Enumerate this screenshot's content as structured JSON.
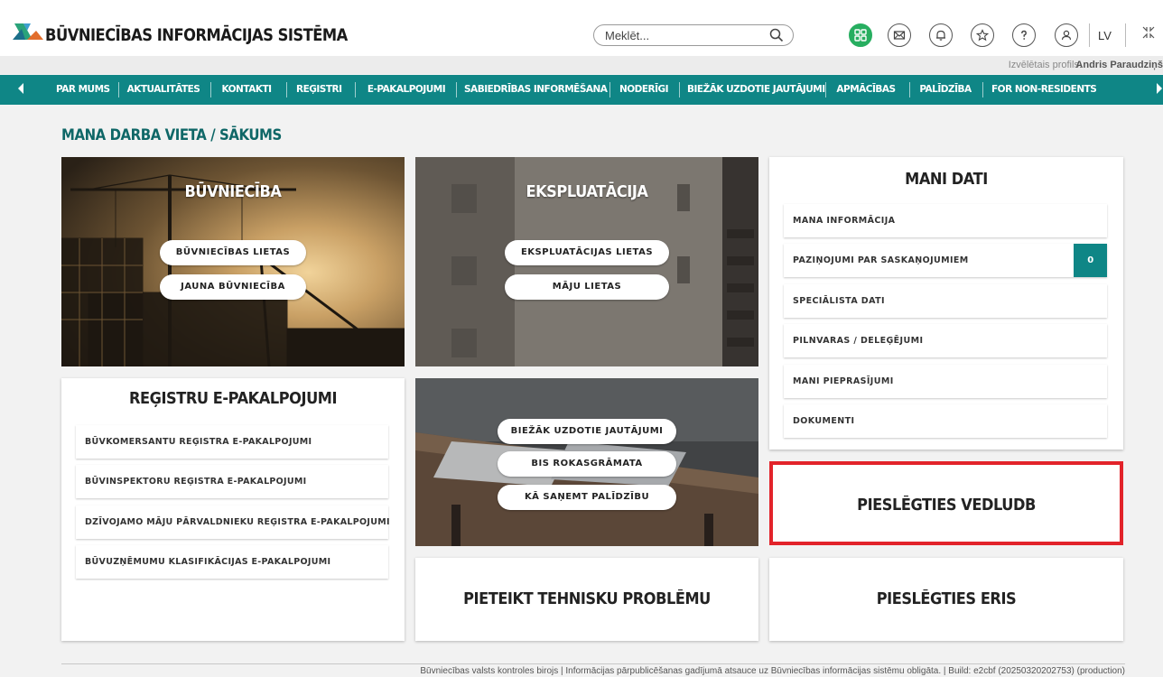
{
  "app": {
    "brand": "BŪVNIECĪBAS INFORMĀCIJAS SISTĒMA",
    "search_placeholder": "Meklēt...",
    "language": "LV",
    "profile_label": "Izvēlētais profils:",
    "profile_name": "Andris Paraudziņš"
  },
  "nav": {
    "items": [
      "PAR MUMS",
      "AKTUALITĀTES",
      "KONTAKTI",
      "REĢISTRI",
      "E-PAKALPOJUMI",
      "SABIEDRĪBAS INFORMĒŠANA",
      "NODERĪGI",
      "BIEŽĀK UZDOTIE JAUTĀJUMI",
      "APMĀCĪBAS",
      "PALĪDZĪBA",
      "FOR NON-RESIDENTS"
    ]
  },
  "page": {
    "title": "MANA DARBA VIETA / SĀKUMS"
  },
  "buvnieciba": {
    "title": "BŪVNIECĪBA",
    "buttons": [
      "BŪVNIECĪBAS LIETAS",
      "JAUNA BŪVNIECĪBA"
    ]
  },
  "ekspluatacija": {
    "title": "EKSPLUATĀCIJA",
    "buttons": [
      "EKSPLUATĀCIJAS LIETAS",
      "MĀJU LIETAS"
    ]
  },
  "mani_dati": {
    "title": "MANI DATI",
    "items": [
      "MANA INFORMĀCIJA",
      "PAZIŅOJUMI PAR SASKAŅOJUMIEM",
      "SPECIĀLISTA DATI",
      "PILNVARAS / DELEĢĒJUMI",
      "MANI PIEPRASĪJUMI",
      "DOKUMENTI"
    ],
    "notification_count": "0"
  },
  "registri": {
    "title": "REĢISTRU E-PAKALPOJUMI",
    "items": [
      "BŪVKOMERSANTU REĢISTRA E-PAKALPOJUMI",
      "BŪVINSPEKTORU REĢISTRA E-PAKALPOJUMI",
      "DZĪVOJAMO MĀJU PĀRVALDNIEKU REĢISTRA E-PAKALPOJUMI",
      "BŪVUZŅĒMUMU KLASIFIKĀCIJAS E-PAKALPOJUMI"
    ]
  },
  "help": {
    "buttons": [
      "BIEŽĀK UZDOTIE JAUTĀJUMI",
      "BIS ROKASGRĀMATA",
      "KĀ SAŅEMT PALĪDZĪBU"
    ]
  },
  "tiles": {
    "vedludb": "PIESLĒGTIES VEDLUDB",
    "tehniska": "PIETEIKT TEHNISKU PROBLĒMU",
    "eris": "PIESLĒGTIES ERIS"
  },
  "footer": {
    "text": "Būvniecības valsts kontroles birojs | Informācijas pārpublicēšanas gadījumā atsauce uz Būvniecības informācijas sistēmu obligāta. | Build: e2cbf (20250320202753) (production)"
  },
  "colors": {
    "teal": "#0f8686",
    "highlight": "#e2232a",
    "green": "#27ae60"
  }
}
